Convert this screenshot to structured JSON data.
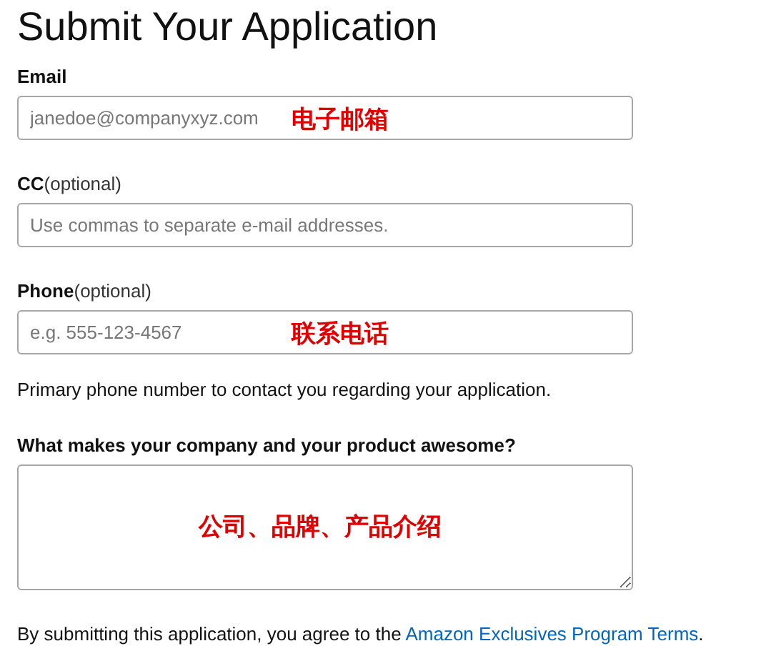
{
  "title": "Submit Your Application",
  "fields": [
    {
      "kind": "input",
      "label": "Email",
      "placeholder": "janedoe@companyxyz.com",
      "annotation": "电子邮箱"
    },
    {
      "kind": "input",
      "label": "CC",
      "label_note": "(optional)",
      "placeholder": "Use commas to separate e-mail addresses."
    },
    {
      "kind": "input",
      "label": "Phone",
      "label_note": "(optional)",
      "placeholder": "e.g. 555-123-4567",
      "annotation": "联系电话",
      "help": "Primary phone number to contact you regarding your application."
    },
    {
      "kind": "textarea",
      "label": "What makes your company and your product awesome?",
      "annotation": "公司、品牌、产品介绍"
    }
  ],
  "footer": {
    "text": "By submitting this application, you agree to the ",
    "link": "Amazon Exclusives Program Terms",
    "end": "."
  }
}
